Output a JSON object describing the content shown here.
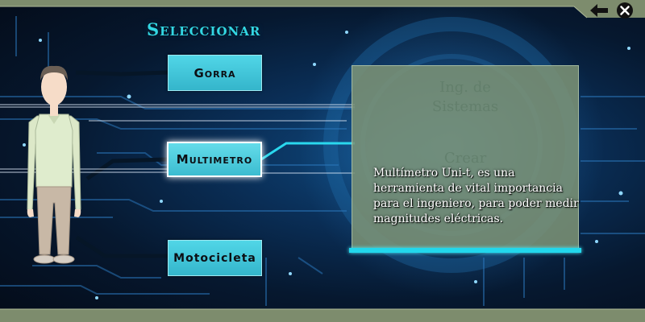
{
  "title": "Seleccionar",
  "options": [
    {
      "label": "Gorra"
    },
    {
      "label": "Multimetro"
    },
    {
      "label": "Motocicleta"
    }
  ],
  "selected_option": "Multimetro",
  "panel": {
    "watermark_lines": [
      "Ing. de",
      "Sistemas",
      "Crear"
    ],
    "description": "Multímetro Uni-t, es una herramienta de vital importancia para el ingeniero, para poder medir magnitudes eléctricas."
  },
  "colors": {
    "accent_cyan": "#34c6dc",
    "button_text": "#0c0f14",
    "panel_bg": "#7e9476",
    "title_color": "#33d6e3"
  },
  "icons": {
    "back": "arrow-left-icon",
    "close": "close-circle-icon"
  }
}
